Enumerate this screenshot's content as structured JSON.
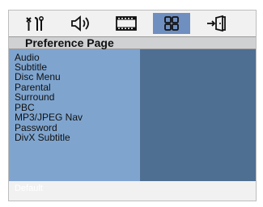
{
  "tabs": [
    {
      "icon": "general-setup-icon"
    },
    {
      "icon": "audio-setup-icon"
    },
    {
      "icon": "video-setup-icon"
    },
    {
      "icon": "preference-page-icon"
    },
    {
      "icon": "exit-icon"
    }
  ],
  "page_title": "Preference Page",
  "menu_items": [
    "Audio",
    "Subtitle",
    "Disc Menu",
    "Parental",
    "Surround",
    "PBC",
    "MP3/JPEG Nav",
    "Password",
    "DivX Subtitle"
  ],
  "footer_text": "Default",
  "colors": {
    "active_tab": "#6f8fc0",
    "menu_bg": "#7fa5cf",
    "value_pane_bg": "#4f6f92",
    "title_bar": "#cfd1d3"
  }
}
